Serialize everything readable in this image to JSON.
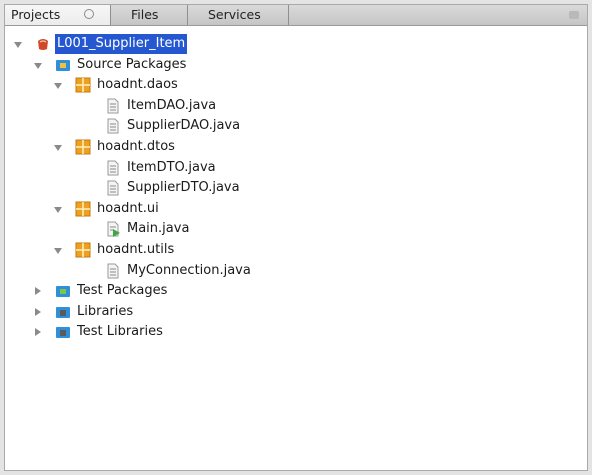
{
  "tabs": [
    {
      "label": "Projects"
    },
    {
      "label": "Files"
    },
    {
      "label": "Services"
    }
  ],
  "tree": [
    {
      "label": "L001_Supplier_Item",
      "icon": "project-icon",
      "toggle": "expanded",
      "selected": true,
      "level": 0
    },
    {
      "label": "Source Packages",
      "icon": "source-folder-icon",
      "toggle": "expanded",
      "level": 1
    },
    {
      "label": "hoadnt.daos",
      "icon": "package-icon",
      "toggle": "expanded",
      "level": 2
    },
    {
      "label": "ItemDAO.java",
      "icon": "java-file-icon",
      "level": 3
    },
    {
      "label": "SupplierDAO.java",
      "icon": "java-file-icon",
      "level": 3
    },
    {
      "label": "hoadnt.dtos",
      "icon": "package-icon",
      "toggle": "expanded",
      "level": 2
    },
    {
      "label": "ItemDTO.java",
      "icon": "java-file-icon",
      "level": 3
    },
    {
      "label": "SupplierDTO.java",
      "icon": "java-file-icon",
      "level": 3
    },
    {
      "label": "hoadnt.ui",
      "icon": "package-icon",
      "toggle": "expanded",
      "level": 2
    },
    {
      "label": "Main.java",
      "icon": "java-main-file-icon",
      "level": 3
    },
    {
      "label": "hoadnt.utils",
      "icon": "package-icon",
      "toggle": "expanded",
      "level": 2
    },
    {
      "label": "MyConnection.java",
      "icon": "java-file-icon",
      "level": 3
    },
    {
      "label": "Test Packages",
      "icon": "test-folder-icon",
      "toggle": "collapsed",
      "level": 1
    },
    {
      "label": "Libraries",
      "icon": "library-icon",
      "toggle": "collapsed",
      "level": 1
    },
    {
      "label": "Test Libraries",
      "icon": "library-icon",
      "toggle": "collapsed",
      "level": 1
    }
  ],
  "colors": {
    "selection": "#2558d0",
    "package": "#f0a020",
    "folder": "#2f8fd8",
    "project": "#d04a2a"
  }
}
